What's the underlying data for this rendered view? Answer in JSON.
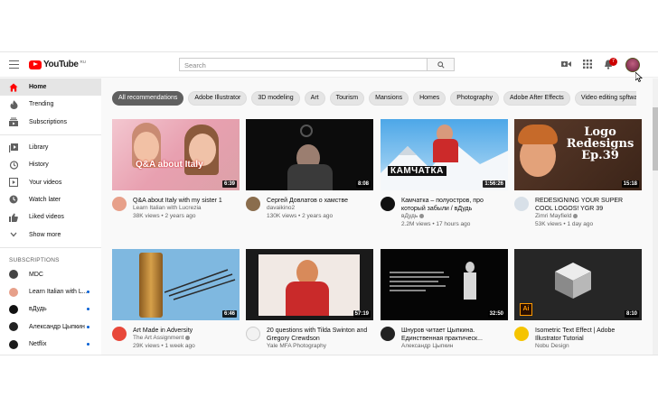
{
  "header": {
    "logo_text": "YouTube",
    "logo_region": "RU",
    "search_placeholder": "Search",
    "notification_count": "7"
  },
  "sidebar": {
    "main": [
      {
        "label": "Home",
        "icon": "home-icon",
        "active": true
      },
      {
        "label": "Trending",
        "icon": "fire-icon"
      },
      {
        "label": "Subscriptions",
        "icon": "subscriptions-icon"
      }
    ],
    "library": [
      {
        "label": "Library",
        "icon": "library-icon"
      },
      {
        "label": "History",
        "icon": "history-icon"
      },
      {
        "label": "Your videos",
        "icon": "video-icon"
      },
      {
        "label": "Watch later",
        "icon": "clock-icon"
      },
      {
        "label": "Liked videos",
        "icon": "thumbs-up-icon"
      },
      {
        "label": "Show more",
        "icon": "chevron-down-icon"
      }
    ],
    "subscriptions_header": "SUBSCRIPTIONS",
    "subscriptions": [
      {
        "label": "MDC",
        "color": "#444444",
        "dot": false
      },
      {
        "label": "Learn Italian with L...",
        "color": "#e7a08a",
        "dot": true
      },
      {
        "label": "вДудь",
        "color": "#111111",
        "dot": true
      },
      {
        "label": "Александр Цыпкин",
        "color": "#222222",
        "dot": true
      },
      {
        "label": "Netflix",
        "color": "#1a1a1a",
        "dot": true
      }
    ]
  },
  "chips": [
    "All recommendations",
    "Adobe Illustrator",
    "3D modeling",
    "Art",
    "Tourism",
    "Mansions",
    "Homes",
    "Photography",
    "Adobe After Effects",
    "Video editing softwa"
  ],
  "videos": [
    {
      "title": "Q&A about Italy with my sister 1",
      "channel": "Learn Italian with Lucrezia",
      "stats": "38K views • 2 years ago",
      "duration": "6:39",
      "thumb_text": "Q&A about Italy",
      "verified": false
    },
    {
      "title": "Сергей Довлатов о хамстве",
      "channel": "davaikino2",
      "stats": "130K views • 2 years ago",
      "duration": "8:08",
      "thumb_text": "",
      "verified": false
    },
    {
      "title": "Камчатка – полуостров, про который забыли / вДудь",
      "channel": "вДудь",
      "stats": "2.2M views • 17 hours ago",
      "duration": "1:56:26",
      "thumb_text": "КАМЧАТКА",
      "verified": true
    },
    {
      "title": "REDESIGNING YOUR SUPER COOL LOGOS! YGR 39",
      "channel": "Zimri Mayfield",
      "stats": "53K views • 1 day ago",
      "duration": "15:18",
      "thumb_text": "Logo Redesigns Ep.39",
      "verified": true
    },
    {
      "title": "Art Made in Adversity",
      "channel": "The Art Assignment",
      "stats": "29K views • 1 week ago",
      "duration": "6:46",
      "thumb_text": "",
      "verified": true
    },
    {
      "title": "20 questions with Tilda Swinton and Gregory Crewdson",
      "channel": "Yale MFA Photography",
      "stats": "",
      "duration": "57:19",
      "thumb_text": "",
      "verified": false
    },
    {
      "title": "Шнуров читает Цыпкина. Единственная практическ...",
      "channel": "Александр Цыпкин",
      "stats": "",
      "duration": "32:50",
      "thumb_text": "",
      "verified": false
    },
    {
      "title": "Isometric Text Effect | Adobe Illustrator Tutorial",
      "channel": "Nobu Design",
      "stats": "",
      "duration": "8:10",
      "thumb_text": "",
      "verified": false
    }
  ]
}
